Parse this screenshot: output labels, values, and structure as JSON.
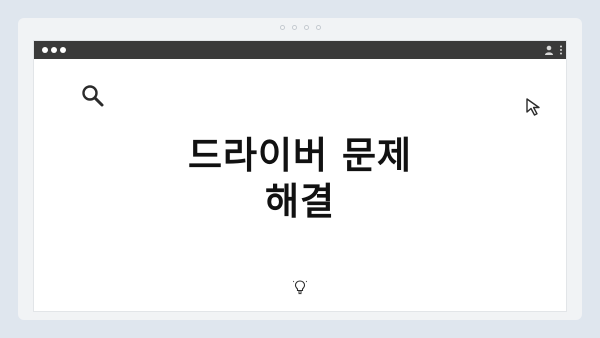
{
  "hero": {
    "title_line1": "드라이버 문제",
    "title_line2": "해결"
  },
  "icons": {
    "titlebar_controls": "traffic-light-dots",
    "profile": "user-icon",
    "menu": "kebab-menu-icon",
    "search": "search-icon",
    "pointer": "cursor-arrow-icon",
    "idea": "lightbulb-icon"
  },
  "colors": {
    "background": "#dfe6ee",
    "frame": "#f1f3f5",
    "titlebar": "#3a3a3a",
    "window": "#ffffff",
    "text": "#111111"
  }
}
